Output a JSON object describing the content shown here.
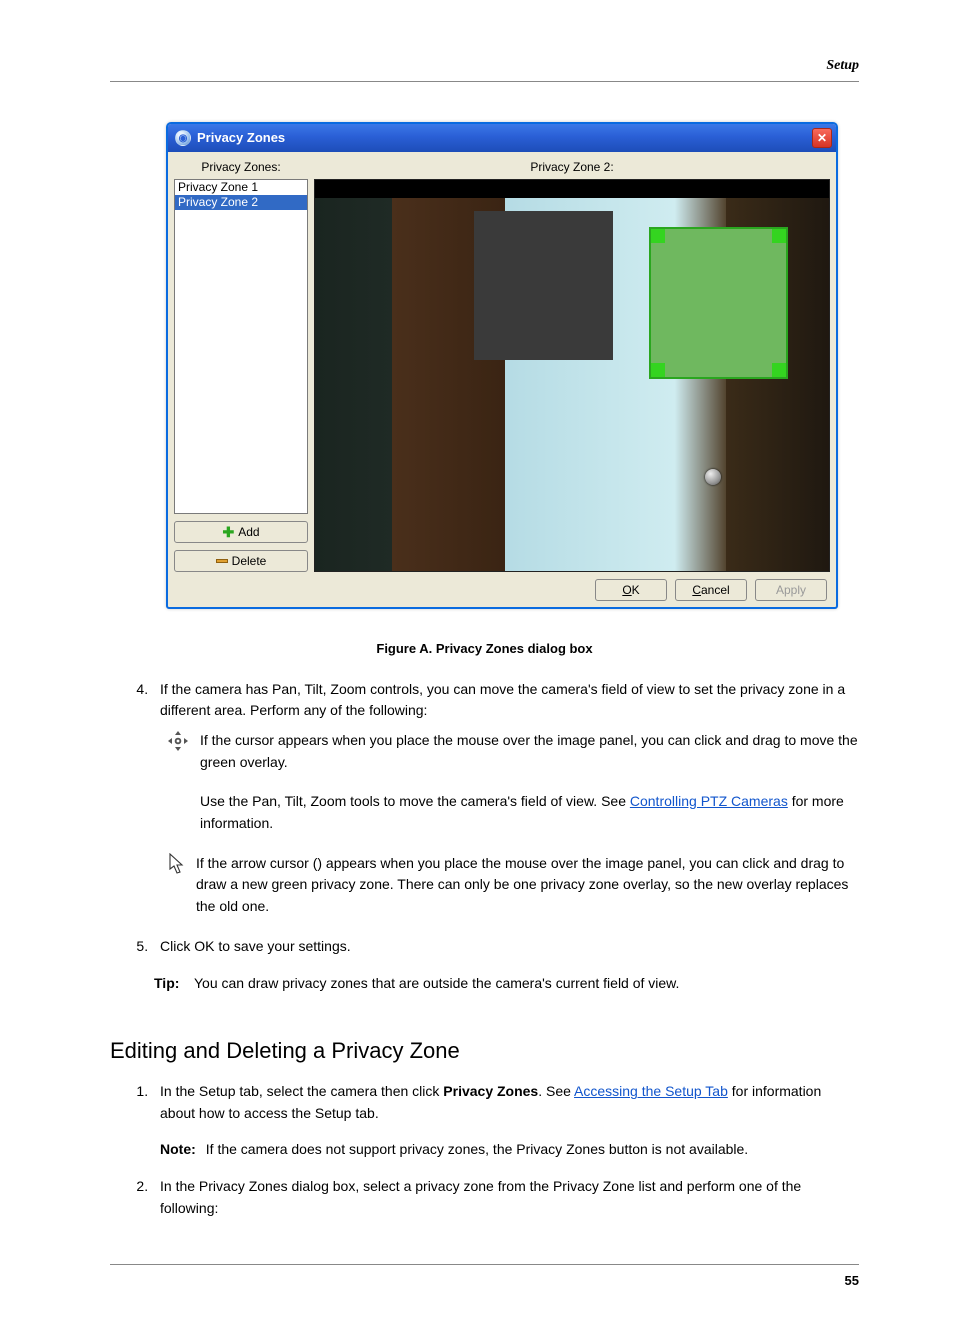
{
  "header": {
    "section": "Setup"
  },
  "dialog": {
    "title": "Privacy Zones",
    "left_label": "Privacy Zones:",
    "right_label": "Privacy Zone 2:",
    "zones": {
      "z1": "Privacy Zone 1",
      "z2": "Privacy Zone 2"
    },
    "add": "Add",
    "delete": "Delete",
    "ok": "K",
    "ok_u": "O",
    "cancel": "ancel",
    "cancel_u": "C",
    "apply": "Apply"
  },
  "figure_caption": "Figure A.    Privacy Zones dialog box",
  "step4": {
    "intro": "If the camera has Pan, Tilt, Zoom controls, you can move the camera's field of view to set the privacy zone in a different area. Perform any of the following:",
    "bullet1a": "If the ",
    "bullet1b": " cursor appears when you place the mouse over the image panel, you can click and drag to move the green overlay.",
    "bullet2a": "Use the Pan, Tilt, Zoom tools to move the camera's field of view. See ",
    "bullet2_link": "Controlling PTZ Cameras",
    "bullet2b": " for more information.",
    "bullet3a": "If the arrow cursor (",
    "bullet3b": ") appears when you place the mouse over the image panel, you can click and drag to draw a new green privacy zone. There can only be one privacy zone overlay, so the new overlay replaces the old one."
  },
  "step5": "Click OK to save your settings.",
  "tip": {
    "label": "Tip:",
    "text": "You can draw privacy zones that are outside the camera's current field of view."
  },
  "section_heading": "Editing and Deleting a Privacy Zone",
  "edit_steps": {
    "s1a": "In the Setup tab, select the camera then click ",
    "s1b": "Privacy Zones",
    "s1note_label": "Note:",
    "s1note": "If the camera does not support privacy zones, the Privacy Zones button is not available.",
    "s1link": "Accessing the Setup Tab",
    "s1link_after": " for information about how to access the Setup tab.",
    "s2": "In the Privacy Zones dialog box, select a privacy zone from the Privacy Zone list and perform one of the following:"
  },
  "footer": {
    "page": "55"
  }
}
